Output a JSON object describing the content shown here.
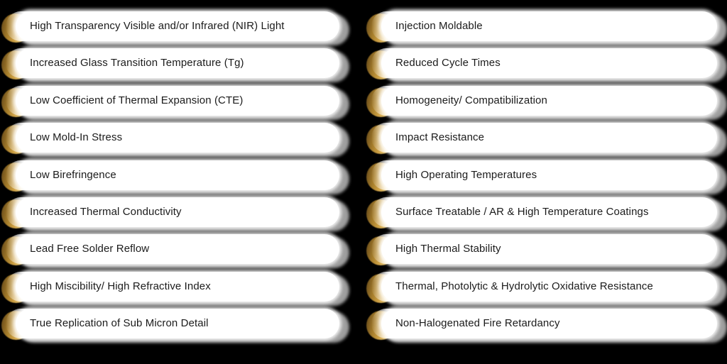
{
  "diagram": {
    "type": "two-column-pill-list",
    "background_color": "#000000",
    "pill_color": "#ffffff",
    "shadow_color": "#a8a8a8",
    "bullet_gradient_from": "#5d4316",
    "bullet_gradient_to": "#fdf6e4",
    "text_color": "#1b1b1b",
    "row_count": 9,
    "column_count": 2
  },
  "columns": [
    {
      "id": "left",
      "items": [
        {
          "label": "High Transparency Visible and/or Infrared (NIR) Light",
          "bullet": "gold-sphere-bullet"
        },
        {
          "label": "Increased Glass Transition Temperature (Tg)",
          "bullet": "gold-sphere-bullet"
        },
        {
          "label": "Low Coefficient of Thermal Expansion (CTE)",
          "bullet": "gold-sphere-bullet"
        },
        {
          "label": "Low Mold-In Stress",
          "bullet": "gold-sphere-bullet"
        },
        {
          "label": "Low Birefringence",
          "bullet": "gold-sphere-bullet"
        },
        {
          "label": "Increased Thermal Conductivity",
          "bullet": "gold-sphere-bullet"
        },
        {
          "label": "Lead Free Solder Reflow",
          "bullet": "gold-sphere-bullet"
        },
        {
          "label": "High Miscibility/ High Refractive Index",
          "bullet": "gold-sphere-bullet"
        },
        {
          "label": "True Replication of Sub Micron Detail",
          "bullet": "gold-sphere-bullet"
        }
      ]
    },
    {
      "id": "right",
      "items": [
        {
          "label": "Injection Moldable",
          "bullet": "gold-sphere-bullet"
        },
        {
          "label": "Reduced Cycle Times",
          "bullet": "gold-sphere-bullet"
        },
        {
          "label": "Homogeneity/ Compatibilization",
          "bullet": "gold-sphere-bullet"
        },
        {
          "label": "Impact Resistance",
          "bullet": "gold-sphere-bullet"
        },
        {
          "label": "High Operating Temperatures",
          "bullet": "gold-sphere-bullet"
        },
        {
          "label": "Surface Treatable / AR & High Temperature Coatings",
          "bullet": "gold-sphere-bullet"
        },
        {
          "label": "High Thermal Stability",
          "bullet": "gold-sphere-bullet"
        },
        {
          "label": "Thermal, Photolytic & Hydrolytic Oxidative Resistance",
          "bullet": "gold-sphere-bullet"
        },
        {
          "label": "Non-Halogenated Fire Retardancy",
          "bullet": "gold-sphere-bullet"
        }
      ]
    }
  ]
}
